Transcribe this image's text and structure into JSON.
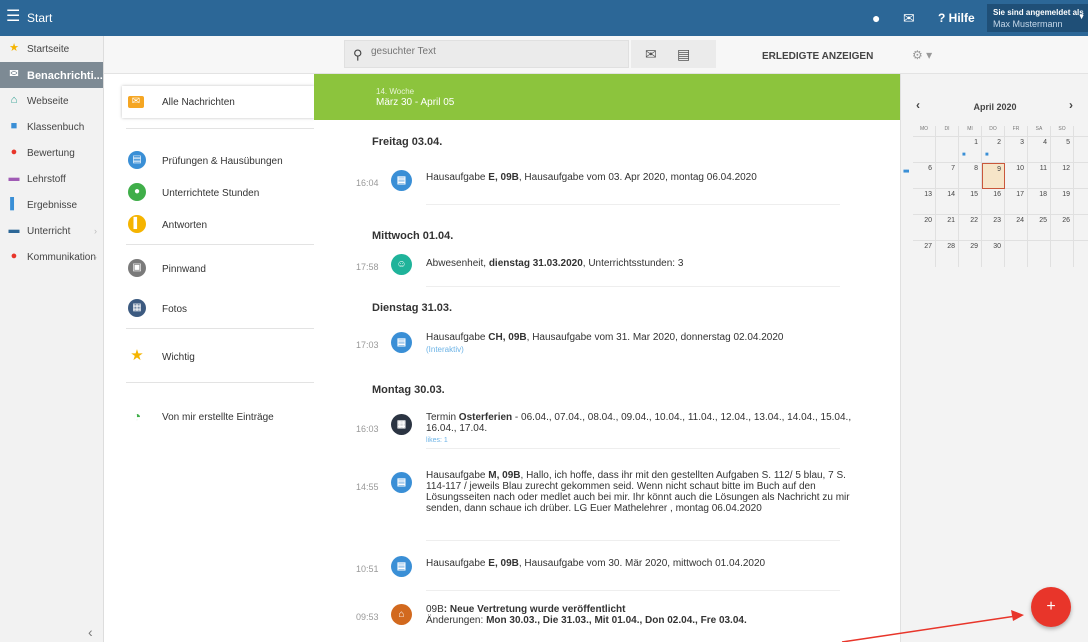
{
  "topbar": {
    "app_title": "Start",
    "help_label": "Hilfe",
    "login_line1": "Sie sind angemeldet als",
    "login_user": "Max Mustermann"
  },
  "sidebar": {
    "items": [
      {
        "label": "Startseite",
        "icon": "star-icon",
        "color": "#f5b400"
      },
      {
        "label": "Benachrichti...",
        "icon": "envelope-icon",
        "color": "#ffffff"
      },
      {
        "label": "Webseite",
        "icon": "home-icon",
        "color": "#2a9d8f"
      },
      {
        "label": "Klassenbuch",
        "icon": "book-icon",
        "color": "#3a8fd6"
      },
      {
        "label": "Bewertung",
        "icon": "rating-icon",
        "color": "#e8352a"
      },
      {
        "label": "Lehrstoff",
        "icon": "folder-icon",
        "color": "#a05bb5"
      },
      {
        "label": "Ergebnisse",
        "icon": "chart-icon",
        "color": "#3a8fd6"
      },
      {
        "label": "Unterricht",
        "icon": "open-book-icon",
        "color": "#2c6797"
      },
      {
        "label": "Kommunikation",
        "icon": "chat-icon",
        "color": "#e8352a"
      }
    ]
  },
  "toolbar": {
    "search_placeholder": "gesuchter Text",
    "done_label": "ERLEDIGTE ANZEIGEN"
  },
  "filters": [
    {
      "label": "Alle Nachrichten",
      "icon": "envelope-icon",
      "color": "#f5a623"
    },
    {
      "label": "Prüfungen & Hausübungen",
      "icon": "clipboard-icon",
      "color": "#3a8fd6"
    },
    {
      "label": "Unterrichtete Stunden",
      "icon": "user-icon",
      "color": "#3fae49"
    },
    {
      "label": "Antworten",
      "icon": "chart-icon",
      "color": "#f5b400"
    },
    {
      "label": "Pinnwand",
      "icon": "pin-icon",
      "color": "#7a7a7a"
    },
    {
      "label": "Fotos",
      "icon": "photo-icon",
      "color": "#3c5a80"
    },
    {
      "label": "Wichtig",
      "icon": "star-icon",
      "color": "#f5b400"
    },
    {
      "label": "Von mir erstellte Einträge",
      "icon": "timer-icon",
      "color": "#3fae49"
    }
  ],
  "week": {
    "label": "14. Woche",
    "range": "März 30 - April 05"
  },
  "days": [
    {
      "title": "Freitag 03.04."
    },
    {
      "title": "Mittwoch 01.04."
    },
    {
      "title": "Dienstag 31.03."
    },
    {
      "title": "Montag 30.03."
    }
  ],
  "entries": [
    {
      "time": "16:04",
      "icon": "homework-icon",
      "color": "#3a8fd6",
      "segments": [
        "Hausaufgabe ",
        "E, 09B",
        ", Hausaufgabe vom 03. Apr 2020, montag 06.04.2020"
      ]
    },
    {
      "time": "17:58",
      "icon": "absence-icon",
      "color": "#1fb39a",
      "segments": [
        "Abwesenheit, ",
        "dienstag 31.03.2020",
        ", Unterrichtsstunden: 3"
      ]
    },
    {
      "time": "17:03",
      "icon": "homework-icon",
      "color": "#3a8fd6",
      "segments": [
        "Hausaufgabe ",
        "CH, 09B",
        ", Hausaufgabe vom 31. Mar 2020, donnerstag 02.04.2020"
      ],
      "sub": "(Interaktiv)"
    },
    {
      "time": "16:03",
      "icon": "calendar-event-icon",
      "color": "#2b3442",
      "segments": [
        "Termin ",
        "Osterferien",
        " - 06.04., 07.04., 08.04., 09.04., 10.04., 11.04., 12.04., 13.04., 14.04., 15.04., 16.04., 17.04."
      ],
      "likes": "likes: 1"
    },
    {
      "time": "14:55",
      "icon": "homework-icon",
      "color": "#3a8fd6",
      "segments": [
        "Hausaufgabe ",
        "M, 09B",
        ", Hallo, ich hoffe, dass ihr mit den gestellten Aufgaben S. 112/ 5 blau, 7 S. 114-117 / jeweils Blau zurecht gekommen seid. Wenn nicht schaut bitte im Buch auf den Lösungsseiten nach oder medlet auch bei mir. Ihr könnt auch die Lösungen als Nachricht zu mir senden, dann schaue ich drüber. LG Euer Mathelehrer , montag 06.04.2020"
      ]
    },
    {
      "time": "10:51",
      "icon": "homework-icon",
      "color": "#3a8fd6",
      "segments": [
        "Hausaufgabe ",
        "E, 09B",
        ", Hausaufgabe vom 30. Mär 2020, mittwoch 01.04.2020"
      ]
    },
    {
      "time": "09:53",
      "icon": "substitution-icon",
      "color": "#d2691e",
      "segments": [
        "09B",
        ": Neue Vertretung wurde veröffentlicht"
      ],
      "line2_segments": [
        "Änderungen: ",
        "Mon 30.03., Die 31.03., Mit 01.04., Don 02.04., Fre 03.04."
      ]
    }
  ],
  "calendar": {
    "month": "April 2020",
    "weekdays": [
      "MO",
      "DI",
      "MI",
      "DO",
      "FR",
      "SA",
      "SO"
    ],
    "weeks": [
      [
        "",
        "",
        "1",
        "2",
        "3",
        "4",
        "5"
      ],
      [
        "6",
        "7",
        "8",
        "9",
        "10",
        "11",
        "12"
      ],
      [
        "13",
        "14",
        "15",
        "16",
        "17",
        "18",
        "19"
      ],
      [
        "20",
        "21",
        "22",
        "23",
        "24",
        "25",
        "26"
      ],
      [
        "27",
        "28",
        "29",
        "30",
        "",
        "",
        ""
      ]
    ],
    "today": "9",
    "dot_days": [
      "1",
      "2",
      "6"
    ]
  },
  "fab": {
    "label": "+",
    "color": "#e8352a"
  }
}
